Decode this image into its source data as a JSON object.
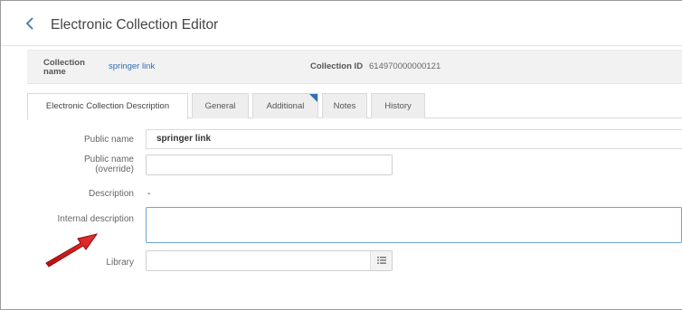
{
  "header": {
    "back_label": "‹",
    "title": "Electronic Collection Editor"
  },
  "info": {
    "collection_name_label_1": "Collection",
    "collection_name_label_2": "name",
    "collection_name_value": "springer link",
    "collection_id_label": "Collection ID",
    "collection_id_value": "614970000000121"
  },
  "tabs": [
    {
      "label": "Electronic Collection Description",
      "active": true
    },
    {
      "label": "General"
    },
    {
      "label": "Additional",
      "flag_color": "#2f6fb3"
    },
    {
      "label": "Notes"
    },
    {
      "label": "History"
    }
  ],
  "form": {
    "public_name_label": "Public name",
    "public_name_value": "springer link",
    "public_name_override_label_1": "Public name",
    "public_name_override_label_2": "(override)",
    "public_name_override_value": "",
    "description_label": "Description",
    "description_value": "-",
    "internal_description_label": "Internal description",
    "internal_description_value": "",
    "library_label": "Library",
    "library_value": "",
    "library_button_icon": "list-icon"
  },
  "annotation": {
    "arrow_color": "#d7191c"
  }
}
